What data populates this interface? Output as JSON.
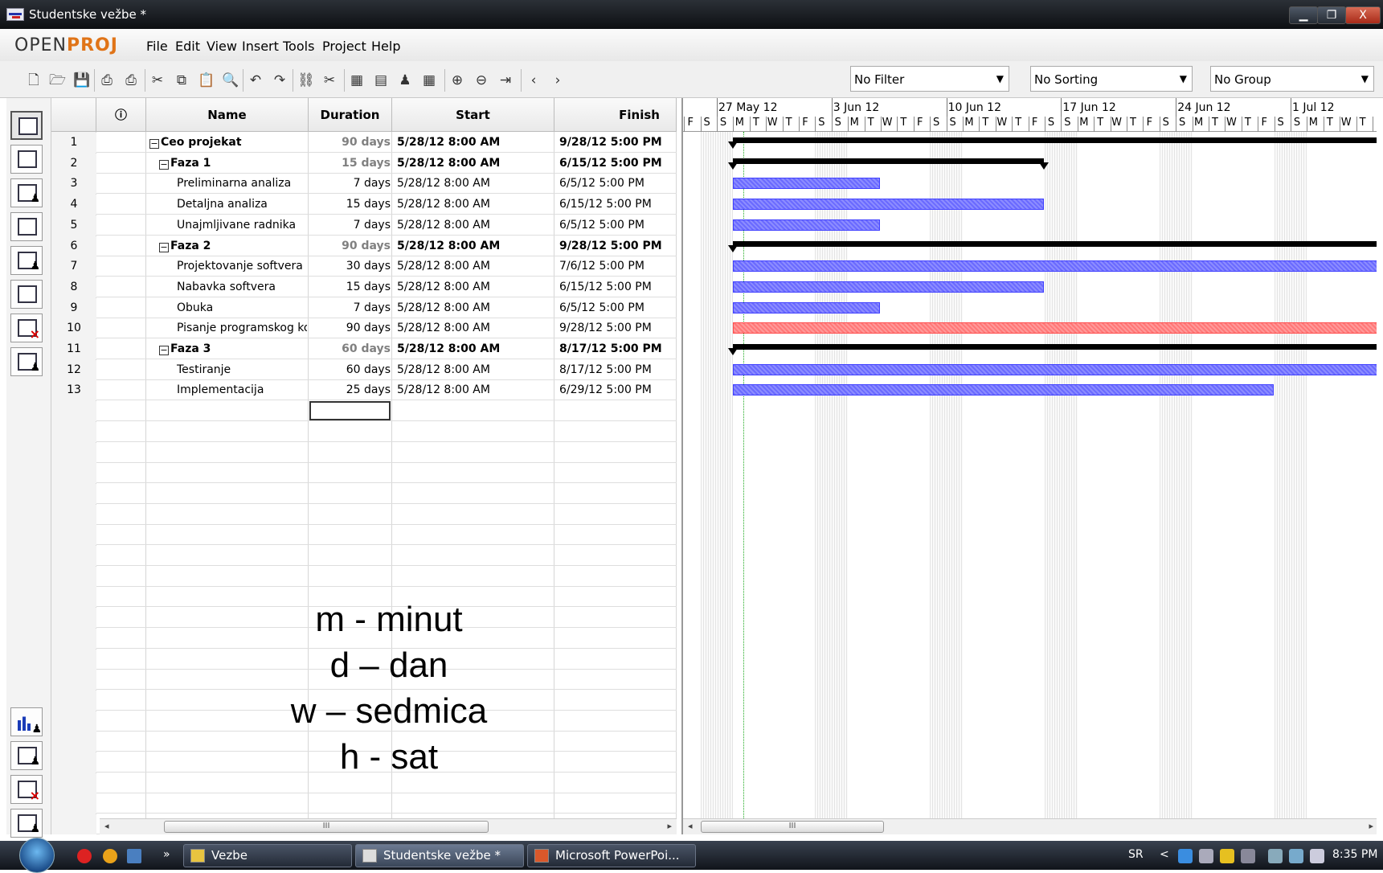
{
  "window": {
    "title": "Studentske vežbe *",
    "minimize": "▁",
    "maximize": "❐",
    "close": "X"
  },
  "logo": {
    "part1": "OPEN",
    "part2": "PROJ"
  },
  "menu": [
    "File",
    "Edit",
    "View",
    "Insert",
    "Tools",
    "Project",
    "Help"
  ],
  "toolbar": {
    "icons": [
      "new-icon",
      "open-icon",
      "save-icon",
      "print-icon",
      "print-preview-icon",
      "cut-icon",
      "copy-icon",
      "paste-icon",
      "find-icon",
      "undo-icon",
      "redo-icon",
      "link-icon",
      "unlink-icon",
      "task-info-icon",
      "notes-icon",
      "assign-resource-icon",
      "calendar-icon",
      "zoom-in-icon",
      "zoom-out-icon",
      "scroll-to-task-icon",
      "back-icon",
      "forward-icon"
    ],
    "filter": "No Filter",
    "sorting": "No Sorting",
    "group": "No Group"
  },
  "columns": {
    "info": "ⓘ",
    "name": "Name",
    "duration": "Duration",
    "start": "Start",
    "finish": "Finish"
  },
  "tasks": [
    {
      "id": "1",
      "name": "Ceo projekat",
      "duration": "90 days",
      "start": "5/28/12 8:00 AM",
      "finish": "9/28/12 5:00 PM",
      "summary": true,
      "toggle": "−"
    },
    {
      "id": "2",
      "name": "Faza 1",
      "duration": "15 days",
      "start": "5/28/12 8:00 AM",
      "finish": "6/15/12 5:00 PM",
      "summary": true,
      "toggle": "−"
    },
    {
      "id": "3",
      "name": "Preliminarna analiza",
      "duration": "7 days",
      "start": "5/28/12 8:00 AM",
      "finish": "6/5/12 5:00 PM"
    },
    {
      "id": "4",
      "name": "Detaljna analiza",
      "duration": "15 days",
      "start": "5/28/12 8:00 AM",
      "finish": "6/15/12 5:00 PM"
    },
    {
      "id": "5",
      "name": "Unajmljivane radnika",
      "duration": "7 days",
      "start": "5/28/12 8:00 AM",
      "finish": "6/5/12 5:00 PM"
    },
    {
      "id": "6",
      "name": "Faza 2",
      "duration": "90 days",
      "start": "5/28/12 8:00 AM",
      "finish": "9/28/12 5:00 PM",
      "summary": true,
      "toggle": "−"
    },
    {
      "id": "7",
      "name": "Projektovanje softvera",
      "duration": "30 days",
      "start": "5/28/12 8:00 AM",
      "finish": "7/6/12 5:00 PM"
    },
    {
      "id": "8",
      "name": "Nabavka softvera",
      "duration": "15 days",
      "start": "5/28/12 8:00 AM",
      "finish": "6/15/12 5:00 PM"
    },
    {
      "id": "9",
      "name": "Obuka",
      "duration": "7 days",
      "start": "5/28/12 8:00 AM",
      "finish": "6/5/12 5:00 PM"
    },
    {
      "id": "10",
      "name": "Pisanje programskog koda",
      "duration": "90 days",
      "start": "5/28/12 8:00 AM",
      "finish": "9/28/12 5:00 PM",
      "critical": true
    },
    {
      "id": "11",
      "name": "Faza 3",
      "duration": "60 days",
      "start": "5/28/12 8:00 AM",
      "finish": "8/17/12 5:00 PM",
      "summary": true,
      "toggle": "−"
    },
    {
      "id": "12",
      "name": "Testiranje",
      "duration": "60 days",
      "start": "5/28/12 8:00 AM",
      "finish": "8/17/12 5:00 PM"
    },
    {
      "id": "13",
      "name": "Implementacija",
      "duration": "25 days",
      "start": "5/28/12 8:00 AM",
      "finish": "6/29/12 5:00 PM"
    }
  ],
  "overlay": [
    "m - minut",
    "d – dan",
    "w – sedmica",
    "h - sat"
  ],
  "gantt": {
    "weeks": [
      "27 May 12",
      "3 Jun 12",
      "10 Jun 12",
      "17 Jun 12",
      "24 Jun 12",
      "1 Jul 12"
    ],
    "days_before": [
      "F",
      "S"
    ],
    "days": [
      "S",
      "M",
      "T",
      "W",
      "T",
      "F",
      "S"
    ]
  },
  "scroll": {
    "thumb": "III",
    "left": "◂",
    "right": "▸"
  },
  "taskbar": {
    "items": [
      "Vezbe",
      "Studentske vežbe *",
      "Microsoft PowerPoi..."
    ],
    "chevron": "»",
    "lang": "SR",
    "tray_arrow": "<",
    "clock": "8:35 PM"
  }
}
